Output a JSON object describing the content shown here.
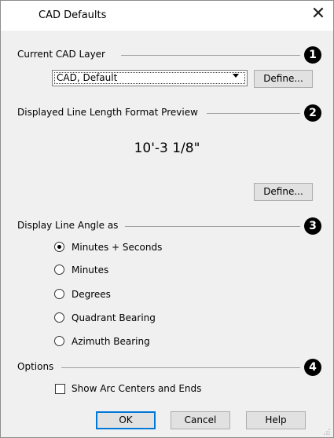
{
  "window": {
    "title": "CAD Defaults"
  },
  "sections": {
    "layer": {
      "label": "Current CAD Layer",
      "badge": "1"
    },
    "preview": {
      "label": "Displayed Line Length Format Preview",
      "badge": "2"
    },
    "angle": {
      "label": "Display Line Angle as",
      "badge": "3"
    },
    "options": {
      "label": "Options",
      "badge": "4"
    }
  },
  "layer_select": {
    "value": "CAD,  Default"
  },
  "buttons": {
    "define_layer": "Define...",
    "define_format": "Define...",
    "ok": "OK",
    "cancel": "Cancel",
    "help": "Help"
  },
  "preview_text": "10'-3 1/8\"",
  "angle_options": [
    {
      "label": "Minutes + Seconds",
      "selected": true
    },
    {
      "label": "Minutes",
      "selected": false
    },
    {
      "label": "Degrees",
      "selected": false
    },
    {
      "label": "Quadrant Bearing",
      "selected": false
    },
    {
      "label": "Azimuth Bearing",
      "selected": false
    }
  ],
  "options": {
    "show_arc_centers": {
      "label": "Show Arc Centers and Ends",
      "checked": false
    }
  },
  "icons": {
    "close": "close-icon",
    "dropdown": "chevron-down-icon"
  }
}
